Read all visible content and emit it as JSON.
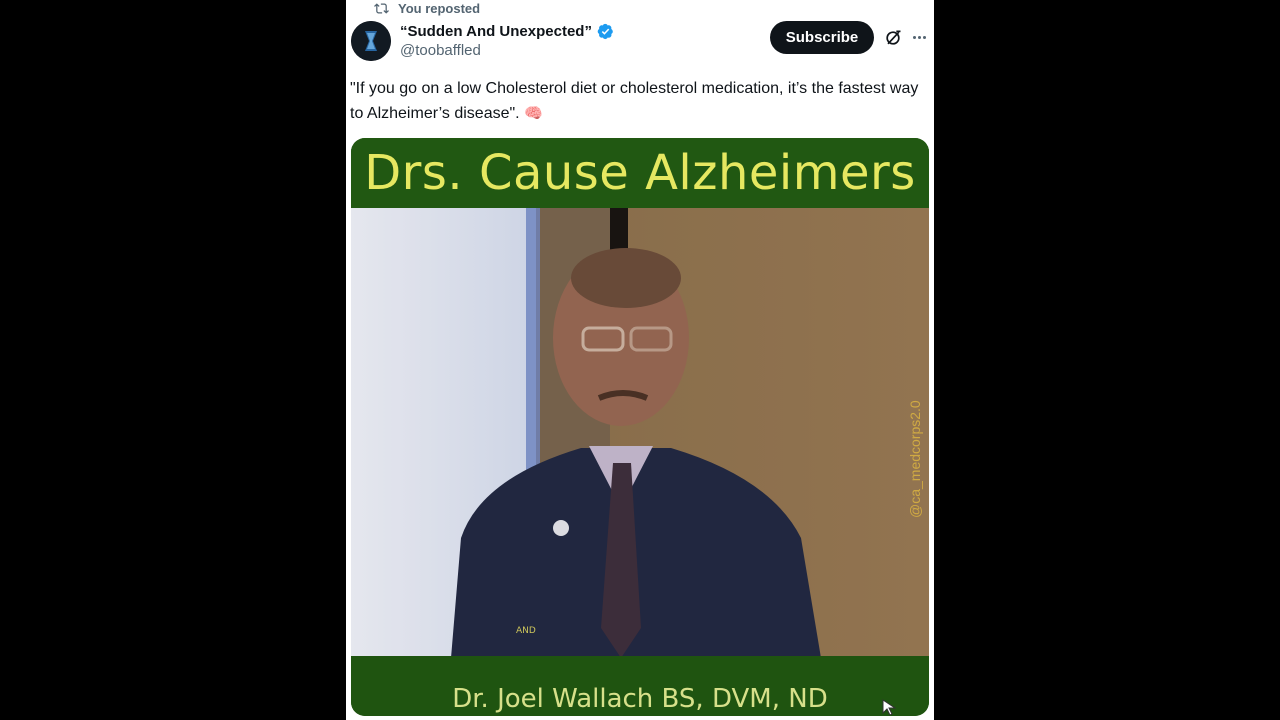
{
  "repost_label": "You reposted",
  "author": {
    "display_name": "“Sudden And Unexpected”",
    "handle": "@toobaffled",
    "verified": true
  },
  "subscribe_label": "Subscribe",
  "tweet": {
    "text": "\"If you go on a low Cholesterol diet or cholesterol medication, it’s the fastest way to Alzheimer’s disease\".",
    "emoji": "🧠"
  },
  "video": {
    "top_banner": "Drs. Cause Alzheimers",
    "bottom_banner": "Dr. Joel Wallach BS, DVM, ND",
    "watermark": "@ca_medcorps2.0",
    "badge_text": "AND"
  },
  "icons": {
    "repost": "repost-icon",
    "verified": "verified-badge-icon",
    "grok": "grok-icon",
    "more": "more-icon"
  },
  "colors": {
    "accent": "#1d9bf0",
    "text_primary": "#0f1419",
    "text_secondary": "#536471",
    "banner_green": "#215812",
    "banner_text": "#e6e861"
  }
}
